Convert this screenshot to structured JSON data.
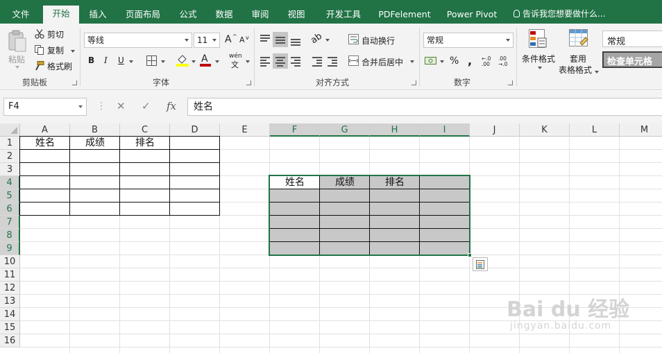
{
  "tabs": [
    {
      "label": "文件",
      "active": false
    },
    {
      "label": "开始",
      "active": true
    },
    {
      "label": "插入",
      "active": false
    },
    {
      "label": "页面布局",
      "active": false
    },
    {
      "label": "公式",
      "active": false
    },
    {
      "label": "数据",
      "active": false
    },
    {
      "label": "审阅",
      "active": false
    },
    {
      "label": "视图",
      "active": false
    },
    {
      "label": "开发工具",
      "active": false
    },
    {
      "label": "PDFelement",
      "active": false
    },
    {
      "label": "Power Pivot",
      "active": false
    }
  ],
  "tell_me": "告诉我您想要做什么...",
  "ribbon": {
    "clipboard": {
      "paste": "粘贴",
      "cut": "剪切",
      "copy": "复制",
      "format_painter": "格式刷",
      "label": "剪贴板"
    },
    "font": {
      "name": "等线",
      "size": "11",
      "grow": "A",
      "shrink": "A",
      "bold": "B",
      "italic": "I",
      "underline": "U",
      "font_color_letter": "A",
      "phonetic": "wén",
      "label": "字体"
    },
    "alignment": {
      "wrap_text": "自动换行",
      "merge_center": "合并后居中",
      "label": "对齐方式"
    },
    "number": {
      "format": "常规",
      "percent": "%",
      "comma": ",",
      "inc_decimal": "←.0 .00",
      "dec_decimal": ".00 →.0",
      "label": "数字"
    },
    "styles": {
      "conditional": "条件格式",
      "table_line1": "套用",
      "table_line2": "表格格式",
      "style_normal": "常规",
      "style_check": "检查单元格"
    }
  },
  "formula_bar": {
    "name_box": "F4",
    "cancel": "✕",
    "enter": "✓",
    "fx": "fx",
    "content": "姓名"
  },
  "columns": [
    "A",
    "B",
    "C",
    "D",
    "E",
    "F",
    "G",
    "H",
    "I",
    "J",
    "K",
    "L",
    "M"
  ],
  "selected_columns": [
    "F",
    "G",
    "H",
    "I"
  ],
  "rows": [
    "1",
    "2",
    "3",
    "4",
    "5",
    "6",
    "7",
    "8",
    "9",
    "10",
    "11",
    "12",
    "13",
    "14",
    "15",
    "16"
  ],
  "selected_rows": [
    "4",
    "5",
    "6",
    "7",
    "8",
    "9"
  ],
  "table1_headers": [
    "姓名",
    "成绩",
    "排名"
  ],
  "table2_headers": [
    "姓名",
    "成绩",
    "排名"
  ],
  "watermark": {
    "main": "Bai du 经验",
    "sub": "jingyan.baidu.com"
  },
  "colors": {
    "accent": "#217346",
    "selection_fill": "#c8c8c8"
  }
}
